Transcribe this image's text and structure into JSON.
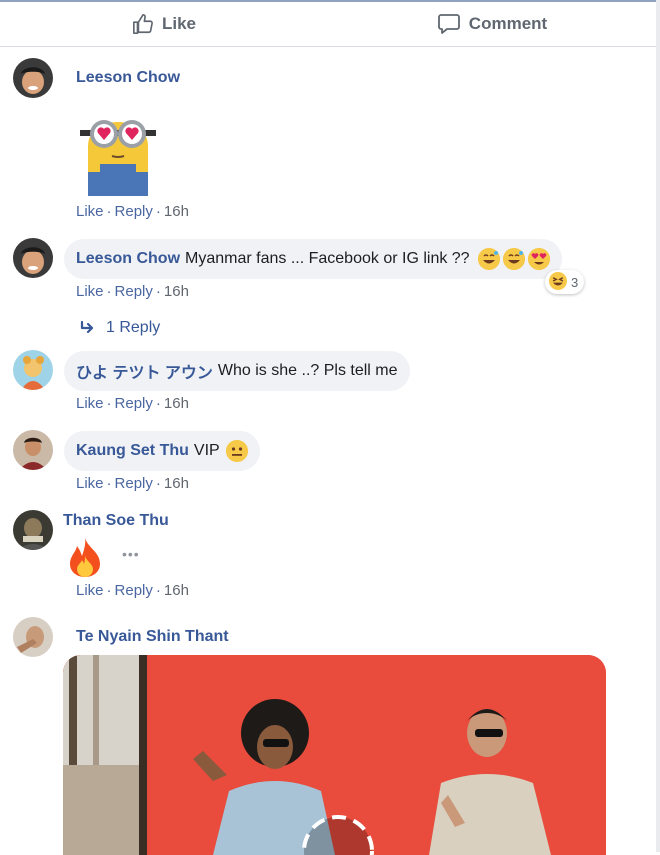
{
  "actions": {
    "like_label": "Like",
    "comment_label": "Comment"
  },
  "comments": [
    {
      "author": "Leeson Chow",
      "text": "",
      "attachment": "minion-sticker",
      "meta": {
        "like": "Like",
        "reply": "Reply",
        "time": "16h"
      }
    },
    {
      "author": "Leeson Chow",
      "text": "Myanmar fans ... Facebook or IG link ??",
      "emojis": [
        "grinning-sweat-icon",
        "grinning-sweat-icon",
        "heart-eyes-icon"
      ],
      "reaction_count": "3",
      "meta": {
        "like": "Like",
        "reply": "Reply",
        "time": "16h"
      },
      "replies_label": "1 Reply"
    },
    {
      "author": "ひよ テツト アウン",
      "text": "Who is she ..? Pls tell me",
      "meta": {
        "like": "Like",
        "reply": "Reply",
        "time": "16h"
      }
    },
    {
      "author": "Kaung Set Thu",
      "text": "VIP",
      "emojis": [
        "neutral-face-icon"
      ],
      "meta": {
        "like": "Like",
        "reply": "Reply",
        "time": "16h"
      }
    },
    {
      "author": "Than Soe Thu",
      "text": "",
      "attachment": "fire-emoji",
      "meta": {
        "like": "Like",
        "reply": "Reply",
        "time": "16h"
      }
    },
    {
      "author": "Te Nyain Shin Thant",
      "text": "",
      "attachment": "gif-two-dancers"
    }
  ],
  "colors": {
    "name": "#385898",
    "bubble": "#f0f2f5",
    "meta": "#4b67a1",
    "gif_bg": "#e94b3c"
  }
}
